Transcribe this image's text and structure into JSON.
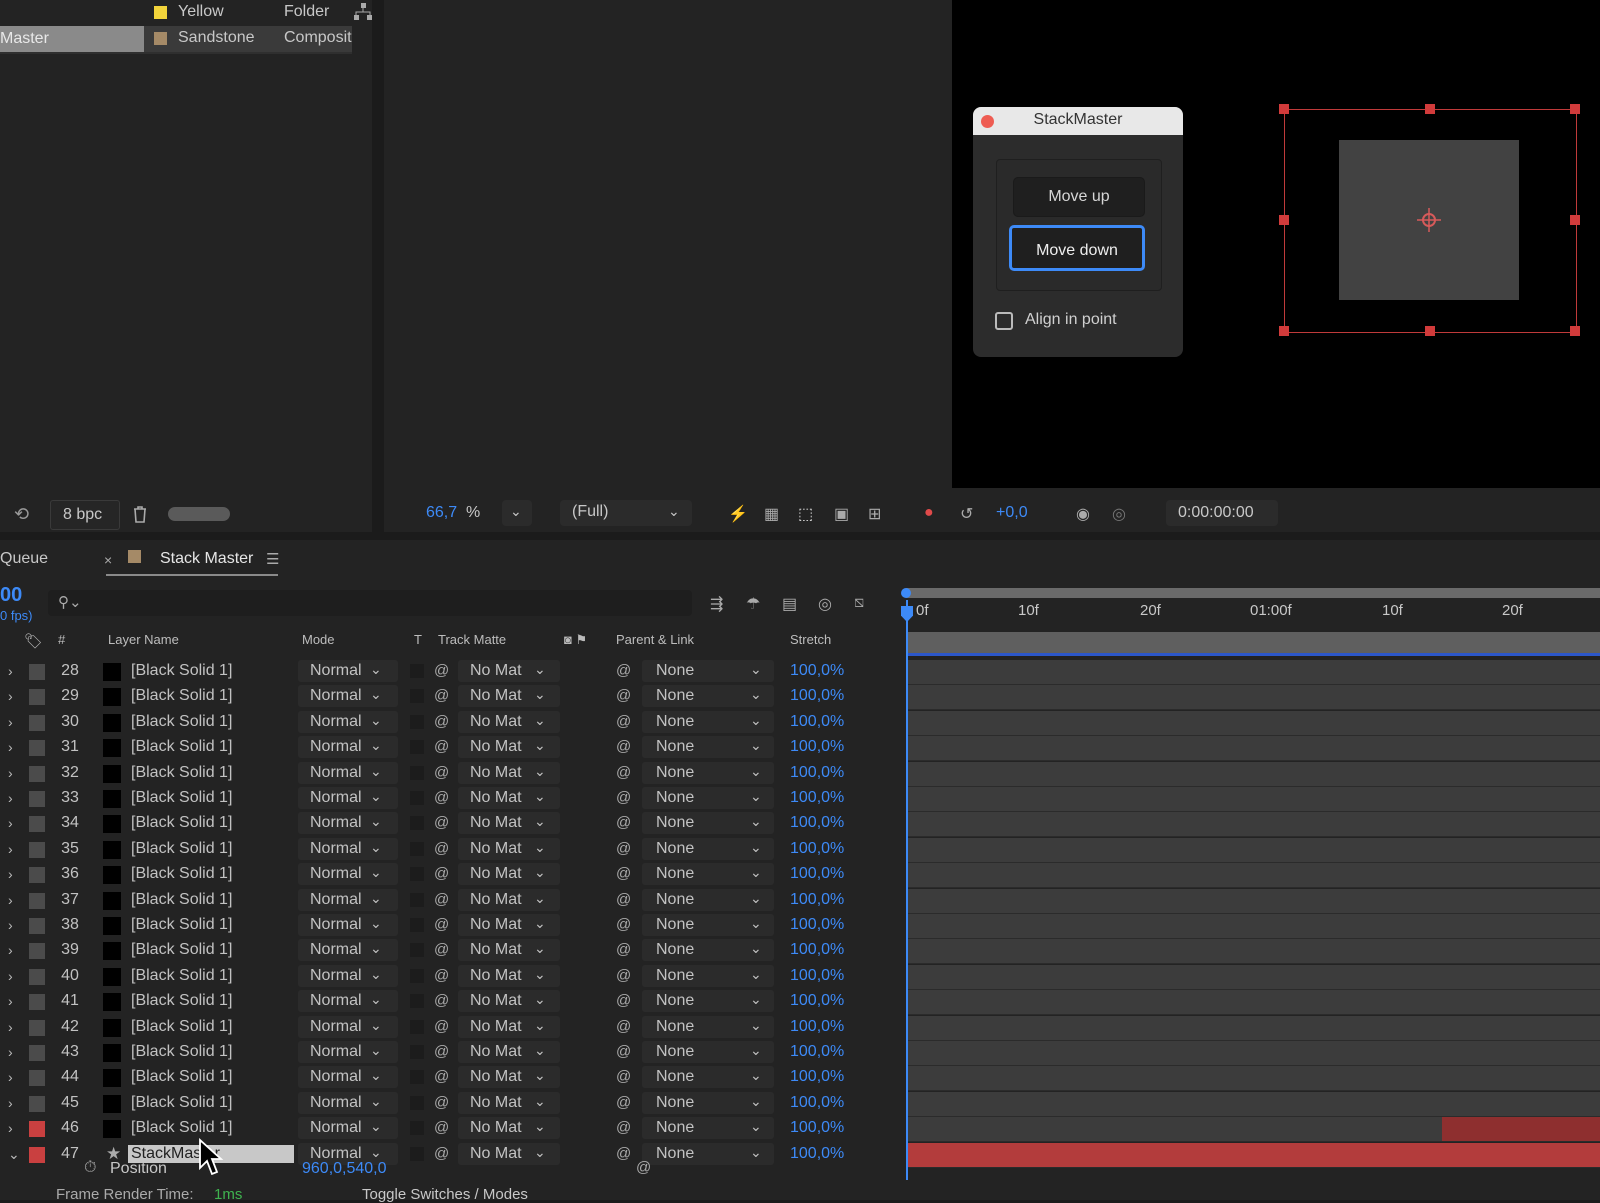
{
  "project": {
    "items": [
      {
        "name": "Yellow",
        "type": "Folder",
        "color": "#f2d43b"
      },
      {
        "name": "Sandstone",
        "type": "Composit",
        "color": "#a58a67"
      }
    ],
    "selected_label": "Master",
    "bpc": "8 bpc"
  },
  "viewer": {
    "zoom": "66,7",
    "zoom_unit": "%",
    "resolution": "(Full)",
    "exposure": "+0,0",
    "timecode": "0:00:00:00"
  },
  "dialog": {
    "title": "StackMaster",
    "move_up": "Move up",
    "move_down": "Move down",
    "align_label": "Align in point"
  },
  "timeline": {
    "tabs": {
      "queue": "Queue",
      "close": "×",
      "comp": "Stack Master",
      "menu": "☰"
    },
    "current_time": "00",
    "fps": "0 fps)",
    "headers": {
      "num": "#",
      "layer_name": "Layer Name",
      "mode": "Mode",
      "t": "T",
      "track_matte": "Track Matte",
      "parent_link": "Parent & Link",
      "stretch": "Stretch"
    },
    "ruler": [
      "0f",
      "10f",
      "20f",
      "01:00f",
      "10f",
      "20f"
    ],
    "rows": [
      {
        "num": "28",
        "name": "[Black Solid 1]",
        "mode": "Normal",
        "matte": "No Mat",
        "parent": "None",
        "stretch": "100,0%"
      },
      {
        "num": "29",
        "name": "[Black Solid 1]",
        "mode": "Normal",
        "matte": "No Mat",
        "parent": "None",
        "stretch": "100,0%"
      },
      {
        "num": "30",
        "name": "[Black Solid 1]",
        "mode": "Normal",
        "matte": "No Mat",
        "parent": "None",
        "stretch": "100,0%"
      },
      {
        "num": "31",
        "name": "[Black Solid 1]",
        "mode": "Normal",
        "matte": "No Mat",
        "parent": "None",
        "stretch": "100,0%"
      },
      {
        "num": "32",
        "name": "[Black Solid 1]",
        "mode": "Normal",
        "matte": "No Mat",
        "parent": "None",
        "stretch": "100,0%"
      },
      {
        "num": "33",
        "name": "[Black Solid 1]",
        "mode": "Normal",
        "matte": "No Mat",
        "parent": "None",
        "stretch": "100,0%"
      },
      {
        "num": "34",
        "name": "[Black Solid 1]",
        "mode": "Normal",
        "matte": "No Mat",
        "parent": "None",
        "stretch": "100,0%"
      },
      {
        "num": "35",
        "name": "[Black Solid 1]",
        "mode": "Normal",
        "matte": "No Mat",
        "parent": "None",
        "stretch": "100,0%"
      },
      {
        "num": "36",
        "name": "[Black Solid 1]",
        "mode": "Normal",
        "matte": "No Mat",
        "parent": "None",
        "stretch": "100,0%"
      },
      {
        "num": "37",
        "name": "[Black Solid 1]",
        "mode": "Normal",
        "matte": "No Mat",
        "parent": "None",
        "stretch": "100,0%"
      },
      {
        "num": "38",
        "name": "[Black Solid 1]",
        "mode": "Normal",
        "matte": "No Mat",
        "parent": "None",
        "stretch": "100,0%"
      },
      {
        "num": "39",
        "name": "[Black Solid 1]",
        "mode": "Normal",
        "matte": "No Mat",
        "parent": "None",
        "stretch": "100,0%"
      },
      {
        "num": "40",
        "name": "[Black Solid 1]",
        "mode": "Normal",
        "matte": "No Mat",
        "parent": "None",
        "stretch": "100,0%"
      },
      {
        "num": "41",
        "name": "[Black Solid 1]",
        "mode": "Normal",
        "matte": "No Mat",
        "parent": "None",
        "stretch": "100,0%"
      },
      {
        "num": "42",
        "name": "[Black Solid 1]",
        "mode": "Normal",
        "matte": "No Mat",
        "parent": "None",
        "stretch": "100,0%"
      },
      {
        "num": "43",
        "name": "[Black Solid 1]",
        "mode": "Normal",
        "matte": "No Mat",
        "parent": "None",
        "stretch": "100,0%"
      },
      {
        "num": "44",
        "name": "[Black Solid 1]",
        "mode": "Normal",
        "matte": "No Mat",
        "parent": "None",
        "stretch": "100,0%"
      },
      {
        "num": "45",
        "name": "[Black Solid 1]",
        "mode": "Normal",
        "matte": "No Mat",
        "parent": "None",
        "stretch": "100,0%"
      },
      {
        "num": "46",
        "name": "[Black Solid 1]",
        "mode": "Normal",
        "matte": "No Mat",
        "parent": "None",
        "stretch": "100,0%",
        "label_color": "#c94040"
      },
      {
        "num": "47",
        "name": "StackMaster",
        "mode": "Normal",
        "matte": "No Mat",
        "parent": "None",
        "stretch": "100,0%",
        "label_color": "#c94040",
        "selected": true
      }
    ],
    "position": {
      "label": "Position",
      "value": "960,0,540,0"
    },
    "footer": {
      "render_label": "Frame Render Time:",
      "render_value": "1ms",
      "toggle": "Toggle Switches / Modes"
    }
  },
  "colors": {
    "accent": "#3d8af7",
    "label_red": "#c94040",
    "selection": "#c03a3a"
  }
}
